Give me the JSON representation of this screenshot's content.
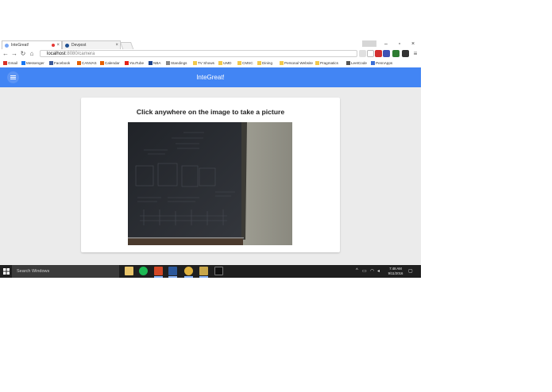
{
  "browser": {
    "tabs": [
      {
        "label": "InteGreat!",
        "active": true
      },
      {
        "label": "Devpost",
        "active": false
      }
    ],
    "address": {
      "host": "localhost",
      "rest": ":8080/camera"
    },
    "bookmarks": [
      {
        "label": "Gmail",
        "icon": "gmail-icon",
        "color": "#d93025"
      },
      {
        "label": "Messenger",
        "icon": "messenger-icon",
        "color": "#1877f2"
      },
      {
        "label": "Facebook",
        "icon": "facebook-icon",
        "color": "#3b5998"
      },
      {
        "label": "CANVAS",
        "icon": "canvas-icon",
        "color": "#e66000"
      },
      {
        "label": "Calendar",
        "icon": "calendar-icon",
        "color": "#e66000"
      },
      {
        "label": "YouTube",
        "icon": "youtube-icon",
        "color": "#e62117"
      },
      {
        "label": "NBA",
        "icon": "nba-icon",
        "color": "#1d428a"
      },
      {
        "label": "Standings",
        "icon": "standings-icon",
        "color": "#888888"
      },
      {
        "label": "TV Shows",
        "icon": "folder-icon",
        "color": "#f2c94c"
      },
      {
        "label": "UMD",
        "icon": "folder-icon",
        "color": "#f2c94c"
      },
      {
        "label": "CMSC",
        "icon": "folder-icon",
        "color": "#f2c94c"
      },
      {
        "label": "Dining",
        "icon": "folder-icon",
        "color": "#f2c94c"
      },
      {
        "label": "Personal Website",
        "icon": "folder-icon",
        "color": "#f2c94c"
      },
      {
        "label": "Pragmatics",
        "icon": "folder-icon",
        "color": "#f2c94c"
      },
      {
        "label": "LeetCode",
        "icon": "leetcode-icon",
        "color": "#555555"
      },
      {
        "label": "PennApps",
        "icon": "pennapps-icon",
        "color": "#3b6fd6"
      }
    ]
  },
  "app": {
    "title": "InteGreat!",
    "bar_color": "#4285f4",
    "card_title": "Click anywhere on the image to take a picture"
  },
  "taskbar": {
    "search_placeholder": "Search Windows",
    "time": "7:48 AM",
    "date": "9/11/2016"
  }
}
